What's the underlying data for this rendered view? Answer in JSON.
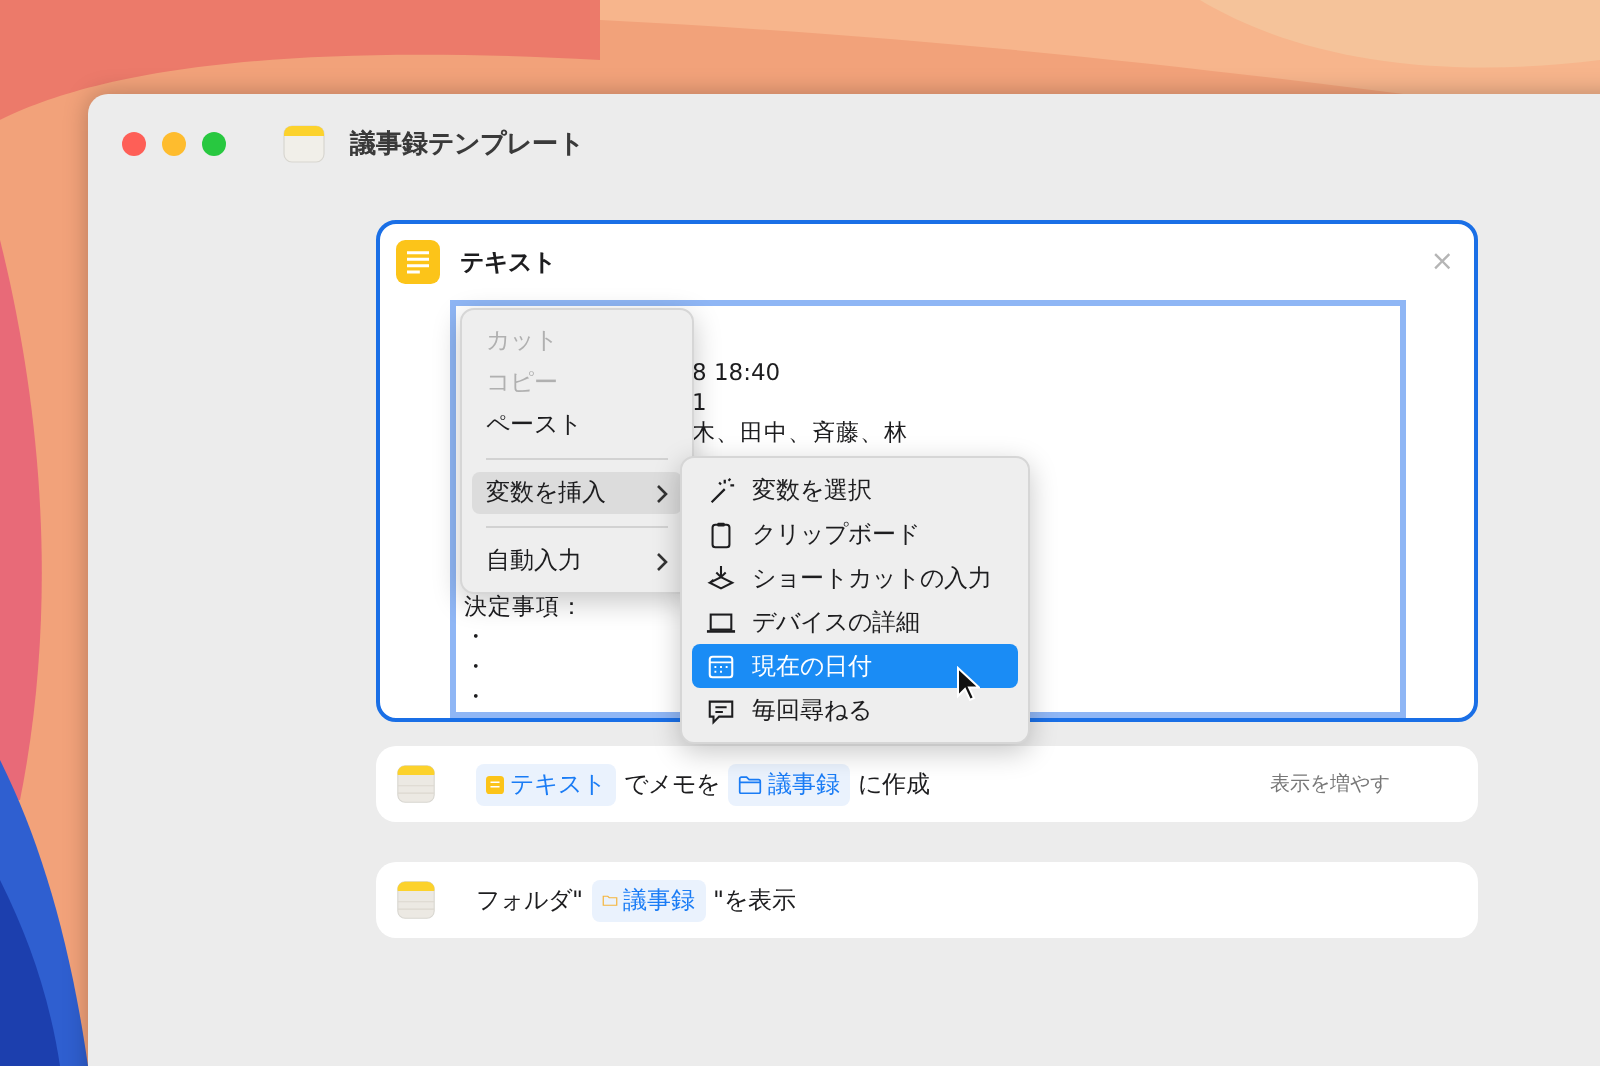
{
  "window": {
    "title": "議事録テンプレート"
  },
  "text_action": {
    "title": "テキスト",
    "close": "×",
    "tails": [
      "8 18:40",
      "1",
      "木、田中、斉藤、林"
    ],
    "lines": [
      "決定事項：",
      "・",
      "・",
      "・"
    ]
  },
  "context_menu": {
    "items": [
      {
        "kind": "item",
        "label": "カット",
        "disabled": true,
        "selected": false,
        "submenu": false
      },
      {
        "kind": "item",
        "label": "コピー",
        "disabled": true,
        "selected": false,
        "submenu": false
      },
      {
        "kind": "item",
        "label": "ペースト",
        "disabled": false,
        "selected": false,
        "submenu": false
      },
      {
        "kind": "separator"
      },
      {
        "kind": "item",
        "label": "変数を挿入",
        "disabled": false,
        "selected": true,
        "submenu": true
      },
      {
        "kind": "separator"
      },
      {
        "kind": "item",
        "label": "自動入力",
        "disabled": false,
        "selected": false,
        "submenu": true
      }
    ]
  },
  "submenu": {
    "items": [
      {
        "kind": "wand",
        "label": "変数を選択",
        "selected": false
      },
      {
        "kind": "clipboard",
        "label": "クリップボード",
        "selected": false
      },
      {
        "kind": "layers",
        "label": "ショートカットの入力",
        "selected": false
      },
      {
        "kind": "laptop",
        "label": "デバイスの詳細",
        "selected": false
      },
      {
        "kind": "calendar",
        "label": "現在の日付",
        "selected": true
      },
      {
        "kind": "bubble",
        "label": "毎回尋ねる",
        "selected": false
      }
    ]
  },
  "actions": [
    {
      "parts": [
        {
          "kind": "text_token",
          "label": "テキスト"
        },
        {
          "kind": "text",
          "label": "でメモを"
        },
        {
          "kind": "folder_token",
          "label": "議事録"
        },
        {
          "kind": "text",
          "label": "に作成"
        }
      ],
      "more": "表示を増やす"
    },
    {
      "parts": [
        {
          "kind": "text",
          "label": "フォルダ\""
        },
        {
          "kind": "small_folder_token",
          "label": "議事録"
        },
        {
          "kind": "text",
          "label": "\"を表示"
        }
      ]
    }
  ]
}
